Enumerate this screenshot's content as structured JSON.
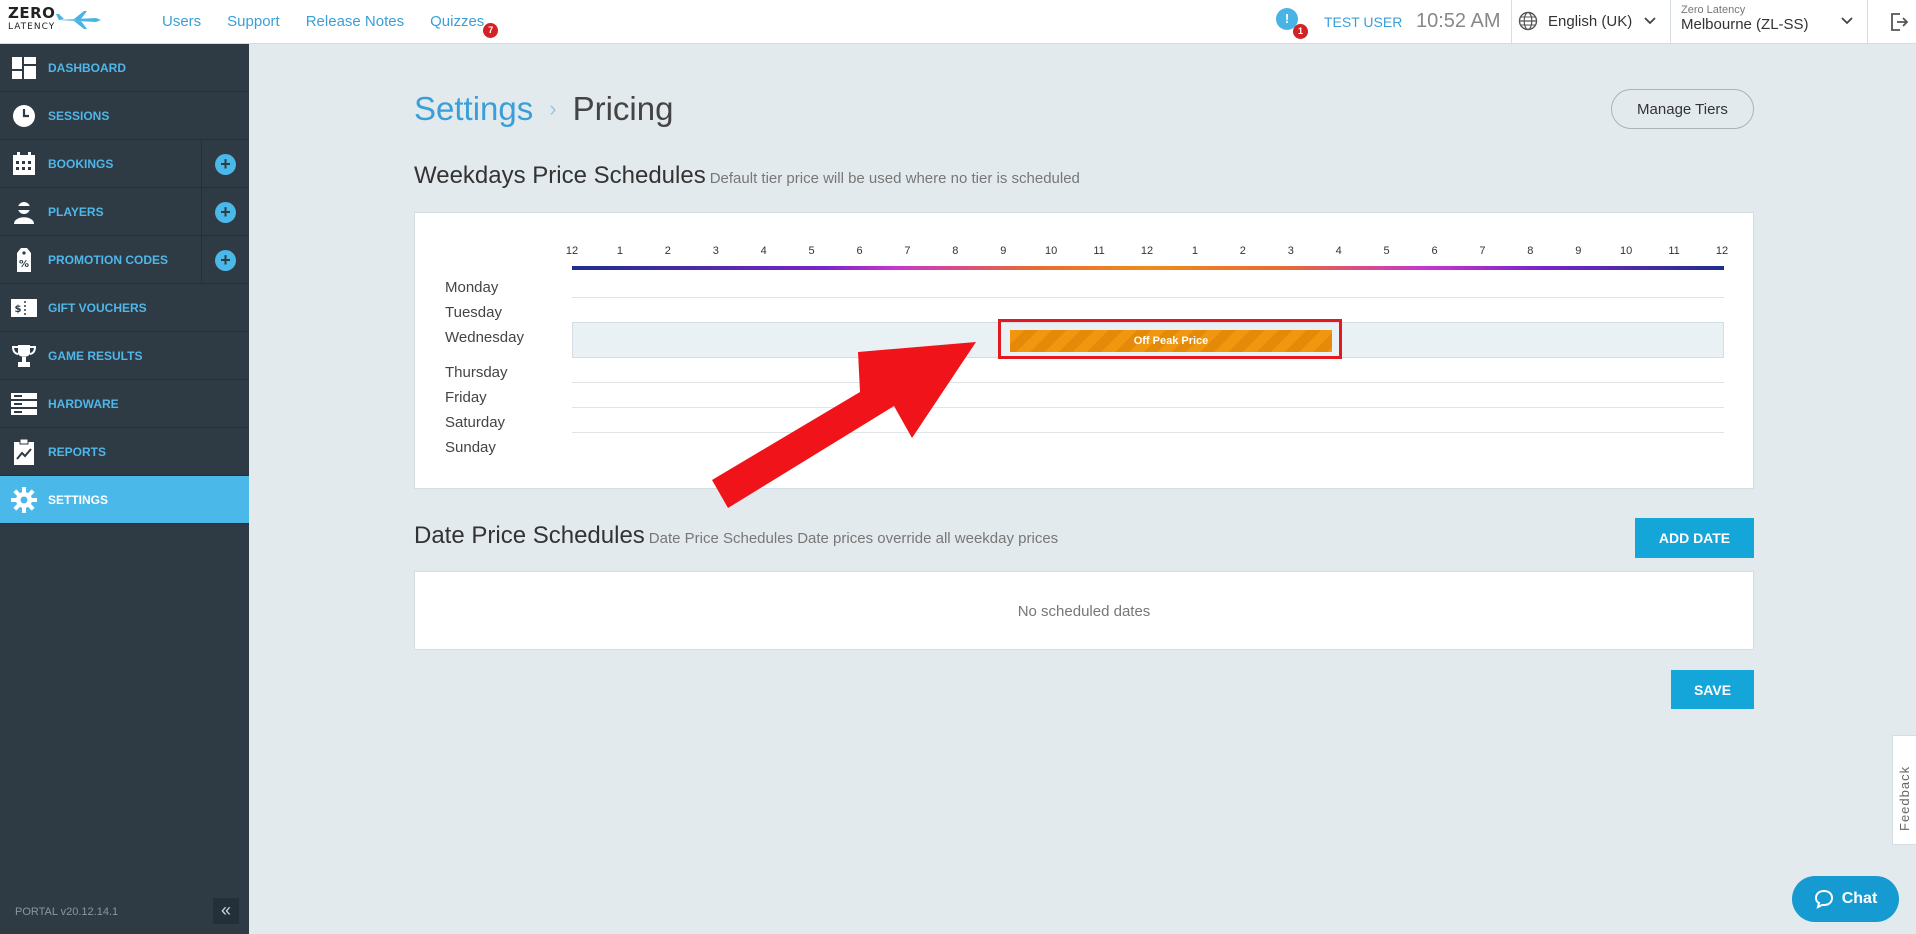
{
  "header": {
    "logo": {
      "line1": "ZERO",
      "line2": "LATENCY"
    },
    "nav": [
      {
        "label": "Users"
      },
      {
        "label": "Support"
      },
      {
        "label": "Release Notes"
      },
      {
        "label": "Quizzes",
        "badge": "7"
      }
    ],
    "notifications": {
      "icon": "!",
      "count": "1"
    },
    "user": "TEST USER",
    "time": "10:52 AM",
    "language": "English (UK)",
    "location": {
      "org": "Zero Latency",
      "venue": "Melbourne (ZL-SS)"
    }
  },
  "sidebar": {
    "items": [
      {
        "label": "DASHBOARD",
        "icon": "dashboard-icon"
      },
      {
        "label": "SESSIONS",
        "icon": "clock-icon"
      },
      {
        "label": "BOOKINGS",
        "icon": "calendar-icon",
        "add": true
      },
      {
        "label": "PLAYERS",
        "icon": "player-icon",
        "add": true
      },
      {
        "label": "PROMOTION CODES",
        "icon": "promo-icon",
        "add": true
      },
      {
        "label": "GIFT VOUCHERS",
        "icon": "voucher-icon"
      },
      {
        "label": "GAME RESULTS",
        "icon": "trophy-icon"
      },
      {
        "label": "HARDWARE",
        "icon": "server-icon"
      },
      {
        "label": "REPORTS",
        "icon": "report-icon"
      },
      {
        "label": "SETTINGS",
        "icon": "gear-icon",
        "active": true
      }
    ],
    "version": "PORTAL v20.12.14.1",
    "collapse_label": "«"
  },
  "page": {
    "breadcrumb": {
      "parent": "Settings",
      "separator": "›",
      "current": "Pricing"
    },
    "manage_tiers": "Manage Tiers",
    "weekdays": {
      "title": "Weekdays Price Schedules",
      "subtitle": "Default tier price will be used where no tier is scheduled",
      "hours": [
        "12",
        "1",
        "2",
        "3",
        "4",
        "5",
        "6",
        "7",
        "8",
        "9",
        "10",
        "11",
        "12",
        "1",
        "2",
        "3",
        "4",
        "5",
        "6",
        "7",
        "8",
        "9",
        "10",
        "11",
        "12"
      ],
      "days": [
        "Monday",
        "Tuesday",
        "Wednesday",
        "Thursday",
        "Friday",
        "Saturday",
        "Sunday"
      ],
      "block": {
        "label": "Off Peak Price",
        "day": "Wednesday",
        "start_hour": 9.5,
        "end_hour": 16.5,
        "color": "#f0960f"
      }
    },
    "dates": {
      "title": "Date Price Schedules",
      "subtitle": "Date Price Schedules Date prices override all weekday prices",
      "add_label": "ADD DATE",
      "empty": "No scheduled dates"
    },
    "save_label": "SAVE"
  },
  "widgets": {
    "feedback": "Feedback",
    "chat": "Chat"
  },
  "colors": {
    "accent": "#14a5d9",
    "sidebar": "#2e3a44",
    "active": "#4ab8e8",
    "highlight": "#e2191e"
  }
}
